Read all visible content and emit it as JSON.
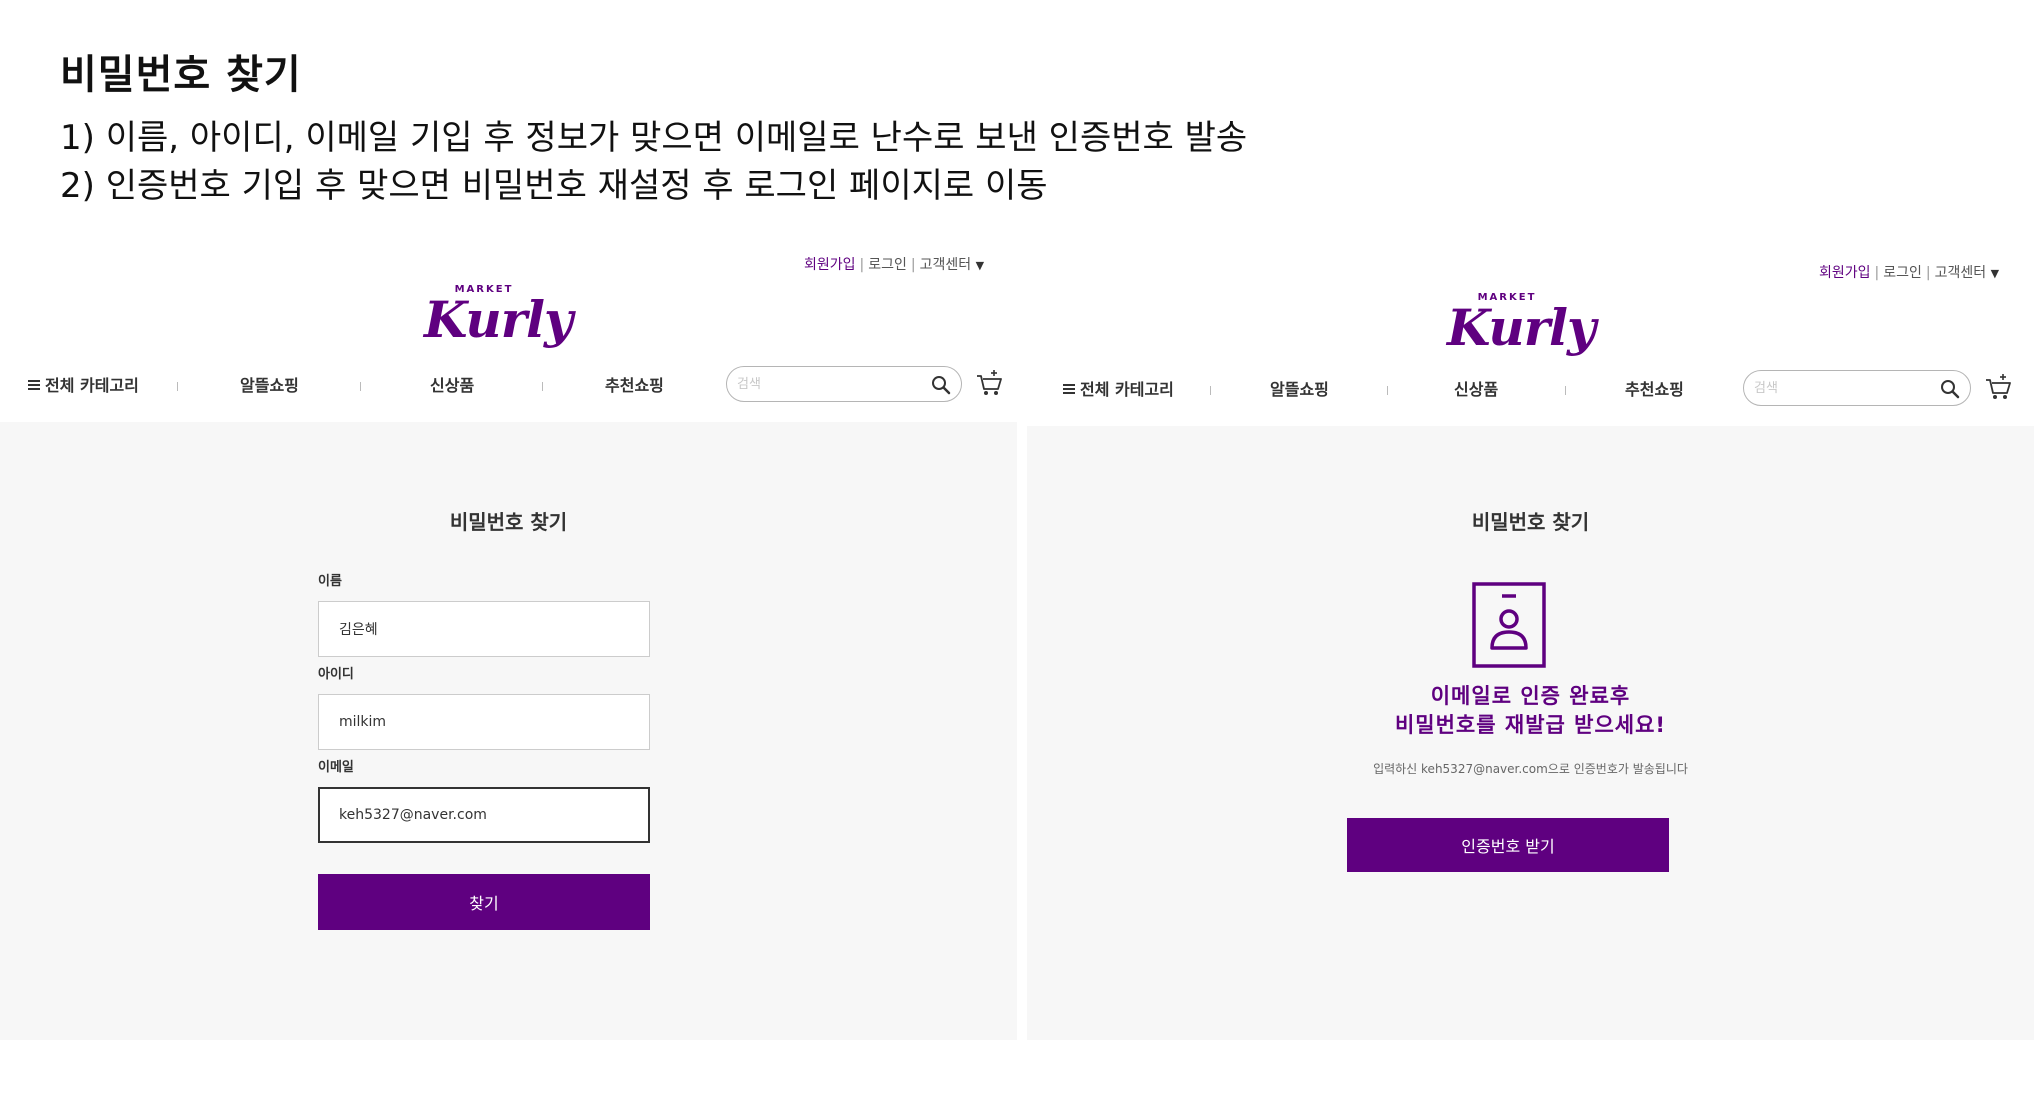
{
  "slide": {
    "title": "비밀번호 찾기",
    "line1": "1) 이름, 아이디, 이메일 기입 후 정보가 맞으면 이메일로 난수로 보낸 인증번호 발송",
    "line2": "2) 인증번호 기입 후 맞으면 비밀번호 재설정 후 로그인 페이지로 이동"
  },
  "header": {
    "signup": "회원가입",
    "login": "로그인",
    "customer_center": "고객센터",
    "logo_small": "MARKET",
    "logo_main": "Kurly",
    "nav": [
      "전체 카테고리",
      "알뜰쇼핑",
      "신상품",
      "추천쇼핑"
    ],
    "search_placeholder": "검색"
  },
  "left_panel": {
    "page_title": "비밀번호 찾기",
    "name_label": "이름",
    "name_value": "김은혜",
    "id_label": "아이디",
    "id_value": "milkim",
    "email_label": "이메일",
    "email_value": "keh5327@naver.com",
    "submit_label": "찾기"
  },
  "right_panel": {
    "page_title": "비밀번호 찾기",
    "message_line1": "이메일로 인증 완료후",
    "message_line2": "비밀번호를 재발급 받으세요!",
    "sub_message": "입력하신 keh5327@naver.com으로 인증번호가 발송됩니다",
    "button_label": "인증번호 받기"
  },
  "colors": {
    "accent": "#5f0080",
    "content_bg": "#f7f7f7"
  }
}
